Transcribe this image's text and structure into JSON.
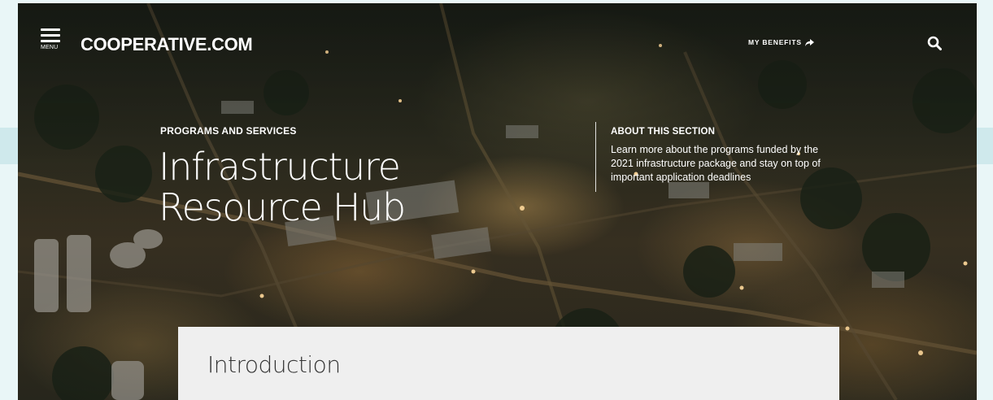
{
  "header": {
    "menu_label": "MENU",
    "logo_text": "COOPERATIVE.COM",
    "benefits_label": "MY BENEFITS"
  },
  "hero": {
    "eyebrow": "PROGRAMS AND SERVICES",
    "title": "Infrastructure Resource Hub",
    "about": {
      "title": "ABOUT THIS SECTION",
      "text": "Learn more about the programs funded by the 2021 infrastructure package and stay on top of important application deadlines"
    }
  },
  "content": {
    "intro_heading": "Introduction"
  },
  "colors": {
    "page_bg": "#e9f6f7",
    "side_band": "#cfe9ec",
    "card_bg": "#efefef",
    "heading_text": "#333333"
  },
  "icons": {
    "menu": "hamburger-icon",
    "benefits": "share-arrow-icon",
    "search": "search-icon"
  }
}
